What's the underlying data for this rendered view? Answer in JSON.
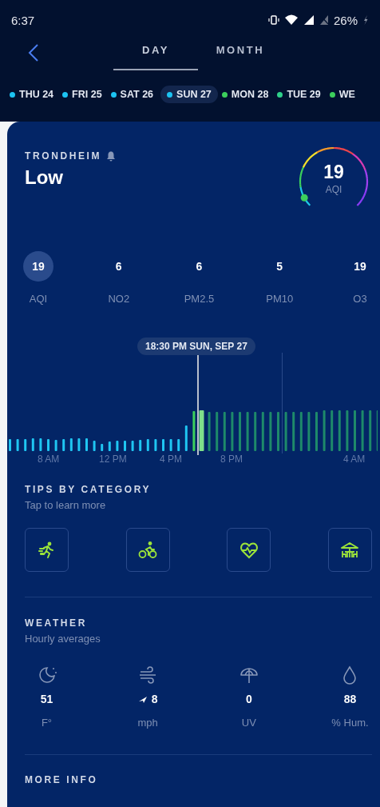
{
  "status_bar": {
    "time": "6:37",
    "battery": "26%"
  },
  "tabs": [
    {
      "label": "DAY",
      "selected": true
    },
    {
      "label": "MONTH",
      "selected": false
    }
  ],
  "days": [
    {
      "label": "THU 24",
      "color": "#1cc3f2",
      "selected": false
    },
    {
      "label": "FRI 25",
      "color": "#1cc3f2",
      "selected": false
    },
    {
      "label": "SAT 26",
      "color": "#1cc3f2",
      "selected": false
    },
    {
      "label": "SUN 27",
      "color": "#1cc3f2",
      "selected": true
    },
    {
      "label": "MON 28",
      "color": "#3ccf5c",
      "selected": false
    },
    {
      "label": "TUE 29",
      "color": "#2fd18a",
      "selected": false
    },
    {
      "label": "WE",
      "color": "#3ccf5c",
      "selected": false
    }
  ],
  "location": {
    "name": "TRONDHEIM",
    "rating": "Low"
  },
  "gauge": {
    "value": "19",
    "unit": "AQI"
  },
  "pollutants": [
    {
      "value": "19",
      "label": "AQI",
      "selected": true
    },
    {
      "value": "6",
      "label": "NO2",
      "selected": false
    },
    {
      "value": "6",
      "label": "PM2.5",
      "selected": false
    },
    {
      "value": "5",
      "label": "PM10",
      "selected": false
    },
    {
      "value": "19",
      "label": "O3",
      "selected": false
    }
  ],
  "timeline": {
    "tooltip": "18:30 PM SUN, SEP 27",
    "ticks": [
      "8 AM",
      "12 PM",
      "4 PM",
      "8 PM",
      "4 AM"
    ]
  },
  "tips": {
    "title": "TIPS BY CATEGORY",
    "subtitle": "Tap to learn more",
    "categories": [
      {
        "kind": "running"
      },
      {
        "kind": "cycling"
      },
      {
        "kind": "health"
      },
      {
        "kind": "outdoor"
      }
    ]
  },
  "weather": {
    "title": "WEATHER",
    "subtitle": "Hourly averages",
    "items": [
      {
        "kind": "temperature",
        "value": "51",
        "unit": "F°"
      },
      {
        "kind": "wind",
        "value": "8",
        "unit": "mph"
      },
      {
        "kind": "uv",
        "value": "0",
        "unit": "UV"
      },
      {
        "kind": "humidity",
        "value": "88",
        "unit": "% Hum."
      }
    ]
  },
  "more_info": {
    "title": "MORE INFO"
  }
}
